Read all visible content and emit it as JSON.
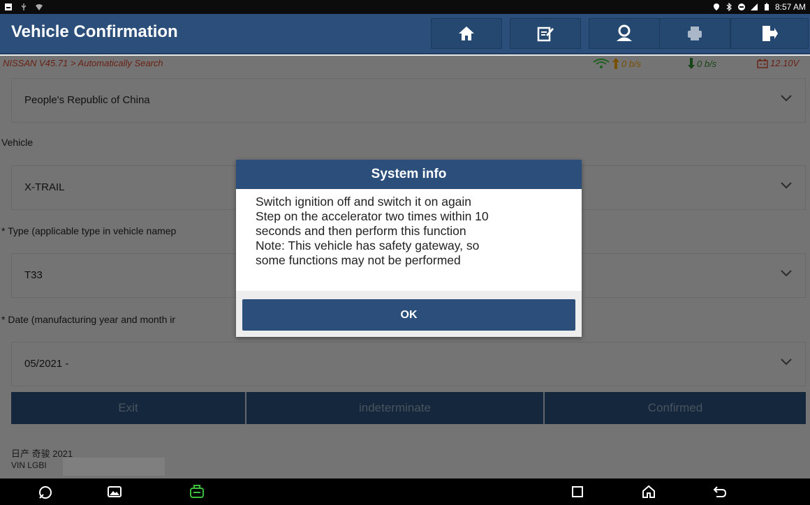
{
  "status_bar": {
    "time": "8:57 AM"
  },
  "header": {
    "title": "Vehicle Confirmation",
    "icons": [
      "home-icon",
      "edit-report-icon",
      "user-profile-icon",
      "print-icon",
      "exit-icon"
    ]
  },
  "breadcrumb": {
    "text": "NISSAN V45.71 > Automatically Search"
  },
  "rates": {
    "up": "0 b/s",
    "down": "0 b/s",
    "voltage": "12.10V"
  },
  "form": {
    "region_value": "People's Republic of China",
    "vehicle_label": "Vehicle",
    "vehicle_value": "X-TRAIL",
    "type_label": "* Type (applicable type in vehicle namep",
    "type_value": "T33",
    "date_label": "* Date (manufacturing year and month ir",
    "date_value": "05/2021 -"
  },
  "actions": {
    "exit": "Exit",
    "indeterminate": "indeterminate",
    "confirmed": "Confirmed"
  },
  "footer": {
    "model": "日产 奇骏 2021",
    "vin": "VIN LGBI"
  },
  "dialog": {
    "title": "System info",
    "lines": [
      "Switch ignition off and switch it on again",
      "Step on the accelerator two times within 10",
      "seconds and then perform this function",
      "Note: This vehicle has safety gateway, so",
      "some functions may not be performed"
    ],
    "ok": "OK"
  },
  "colors": {
    "header": "#2b4f7a",
    "breadcrumb": "#d4432a",
    "up_arrow": "#f0a000",
    "down_arrow": "#2e8b2e",
    "wifi": "#3bbf3b"
  }
}
